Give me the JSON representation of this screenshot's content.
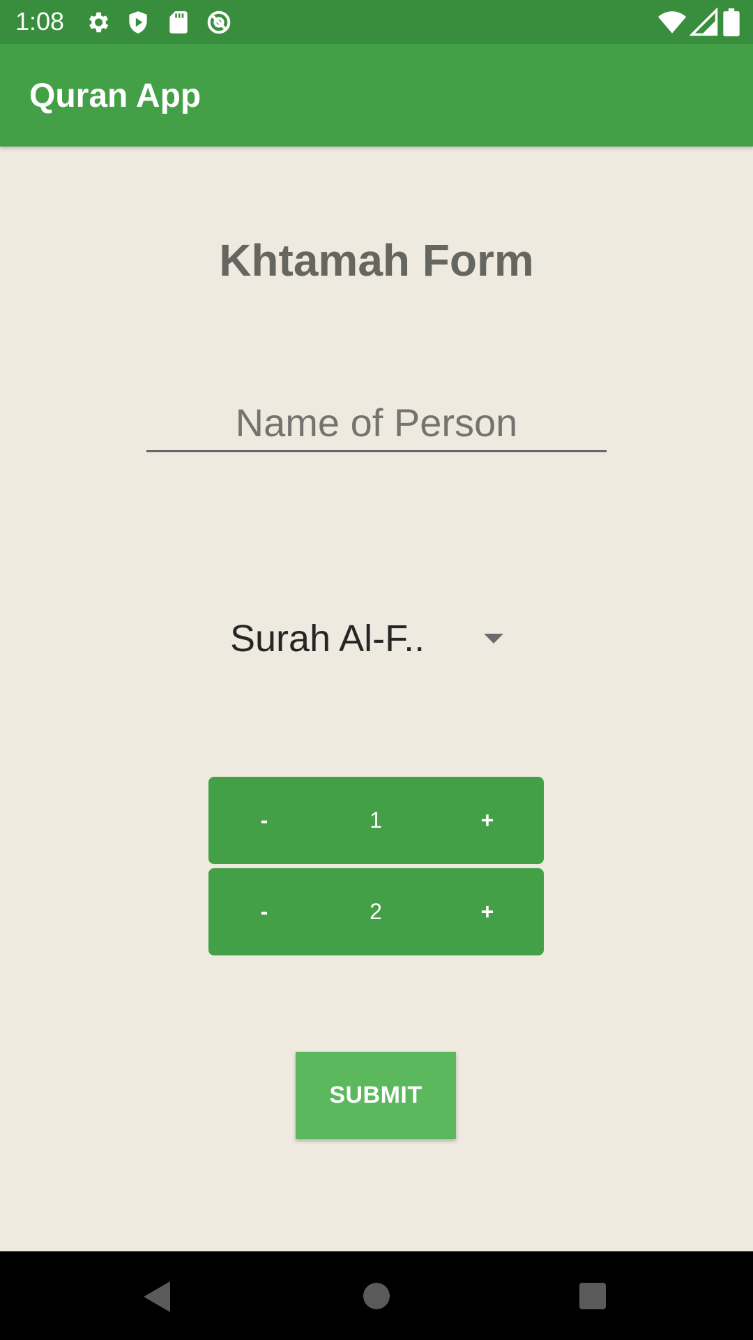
{
  "status_bar": {
    "time": "1:08",
    "left_icons": [
      "gear-icon",
      "shield-icon",
      "sd-card-icon",
      "at-sign-icon"
    ],
    "right_icons": [
      "wifi-icon",
      "signal-icon",
      "battery-icon"
    ]
  },
  "app_bar": {
    "title": "Quran App",
    "color": "#43A047"
  },
  "form": {
    "title": "Khtamah Form",
    "name_input": {
      "value": "",
      "placeholder": "Name of Person"
    },
    "surah_select": {
      "selected": "Surah Al-F.."
    },
    "steppers": [
      {
        "minus_label": "-",
        "value": "1",
        "plus_label": "+"
      },
      {
        "minus_label": "-",
        "value": "2",
        "plus_label": "+"
      }
    ],
    "submit_label": "SUBMIT"
  },
  "colors": {
    "background": "#EEEAE0",
    "status_bar": "#388E3C",
    "accent": "#43A047",
    "submit": "#5CB85C"
  },
  "nav_bar": {
    "icons": [
      "back-icon",
      "home-icon",
      "recents-icon"
    ]
  }
}
